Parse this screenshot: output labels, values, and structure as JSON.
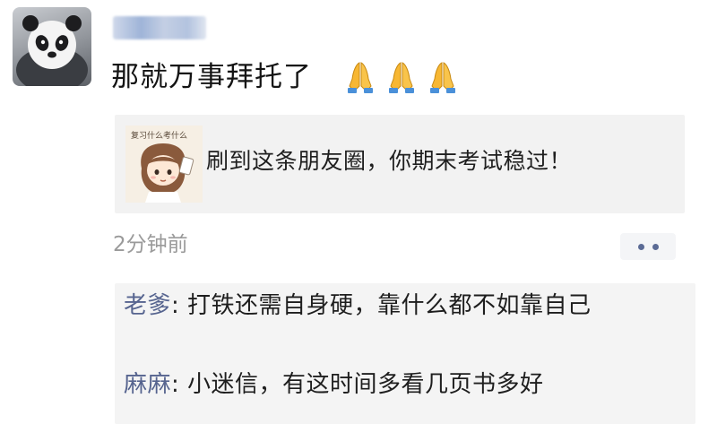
{
  "post": {
    "avatar_icon": "panda-avatar-icon",
    "username": "",
    "text": "那就万事拜托了",
    "emojis": [
      "folded-hands-emoji",
      "folded-hands-emoji",
      "folded-hands-emoji"
    ],
    "timestamp": "2分钟前"
  },
  "share_card": {
    "thumbnail_icon": "cartoon-girl-thumbnail",
    "thumbnail_caption": "复习什么考什么",
    "title": "刷到这条朋友圈，你期末考试稳过！"
  },
  "more_button": {
    "icon": "more-dots-icon"
  },
  "comments": [
    {
      "author": "老爹",
      "separator": ": ",
      "text": "打铁还需自身硬，靠什么都不如靠自己"
    },
    {
      "author": "麻麻",
      "separator": ": ",
      "text": "小迷信，有这时间多看几页书多好"
    }
  ],
  "colors": {
    "author_link": "#56648f",
    "timestamp": "#9a9a9a",
    "card_background": "#f2f2f2"
  }
}
